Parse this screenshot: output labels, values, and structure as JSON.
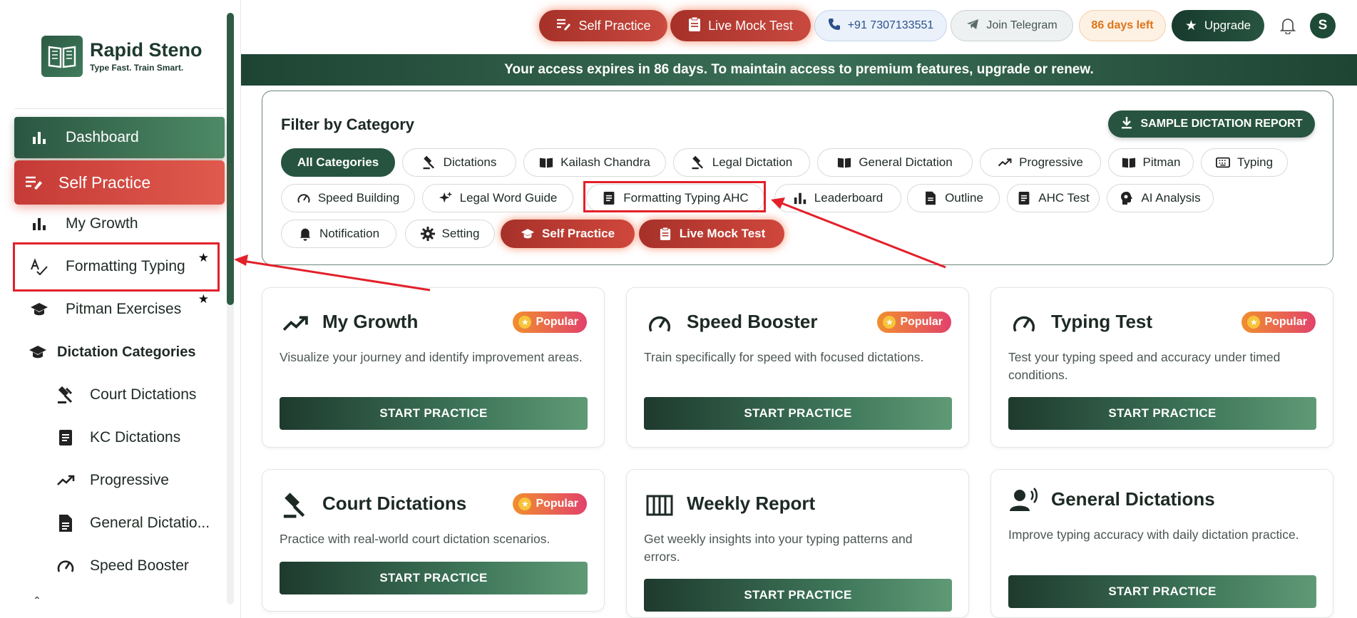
{
  "brand": {
    "title": "Rapid Steno",
    "tagline": "Type Fast. Train Smart."
  },
  "sidebar": {
    "items": [
      {
        "label": "Dashboard",
        "icon": "bar-chart-icon"
      },
      {
        "label": "Self Practice",
        "icon": "edit-list-icon"
      },
      {
        "label": "My Growth",
        "icon": "bar-chart-icon"
      },
      {
        "label": "Formatting Typing",
        "icon": "spellcheck-icon",
        "starred": true
      },
      {
        "label": "Pitman Exercises",
        "icon": "graduation-cap-icon",
        "starred": true
      }
    ],
    "section": {
      "label": "Dictation Categories",
      "icon": "graduation-cap-icon"
    },
    "sub_items": [
      {
        "label": "Court Dictations",
        "icon": "gavel-icon"
      },
      {
        "label": "KC Dictations",
        "icon": "document-icon"
      },
      {
        "label": "Progressive",
        "icon": "trending-up-icon"
      },
      {
        "label": "General Dictatio...",
        "icon": "file-icon"
      },
      {
        "label": "Speed Booster",
        "icon": "speedometer-icon"
      }
    ],
    "star": "★"
  },
  "topbar": {
    "self_practice": "Self Practice",
    "live_mock": "Live Mock Test",
    "phone": "+91 7307133551",
    "telegram": "Join Telegram",
    "days_left": "86 days left",
    "upgrade": "Upgrade",
    "avatar": "S"
  },
  "banner": "Your access expires in 86 days. To maintain access to premium features, upgrade or renew.",
  "filter": {
    "title": "Filter by Category",
    "sample_button": "SAMPLE DICTATION REPORT",
    "chips": [
      "All Categories",
      "Dictations",
      "Kailash Chandra",
      "Legal Dictation",
      "General Dictation",
      "Progressive",
      "Pitman",
      "Typing",
      "Speed Building",
      "Legal Word Guide",
      "Formatting Typing AHC",
      "Leaderboard",
      "Outline",
      "AHC Test",
      "AI Analysis",
      "Notification",
      "Setting",
      "Self Practice",
      "Live Mock Test"
    ]
  },
  "cards": [
    {
      "title": "My Growth",
      "badge": "Popular",
      "desc": "Visualize your journey and identify improvement areas.",
      "button": "START PRACTICE",
      "icon": "trending-up-icon"
    },
    {
      "title": "Speed Booster",
      "badge": "Popular",
      "desc": "Train specifically for speed with focused dictations.",
      "button": "START PRACTICE",
      "icon": "speedometer-icon"
    },
    {
      "title": "Typing Test",
      "badge": "Popular",
      "desc": "Test your typing speed and accuracy under timed conditions.",
      "button": "START PRACTICE",
      "icon": "speedometer-icon"
    },
    {
      "title": "Court Dictations",
      "badge": "Popular",
      "desc": "Practice with real-world court dictation scenarios.",
      "button": "START PRACTICE",
      "icon": "gavel-icon"
    },
    {
      "title": "Weekly Report",
      "badge": "",
      "desc": "Get weekly insights into your typing patterns and errors.",
      "button": "START PRACTICE",
      "icon": "columns-icon"
    },
    {
      "title": "General Dictations",
      "badge": "",
      "desc": "Improve typing accuracy with daily dictation practice.",
      "button": "START PRACTICE",
      "icon": "voice-user-icon"
    }
  ],
  "colors": {
    "brand_green": "#275440",
    "accent_red": "#c9493f",
    "annotation_red": "#e3202a"
  }
}
